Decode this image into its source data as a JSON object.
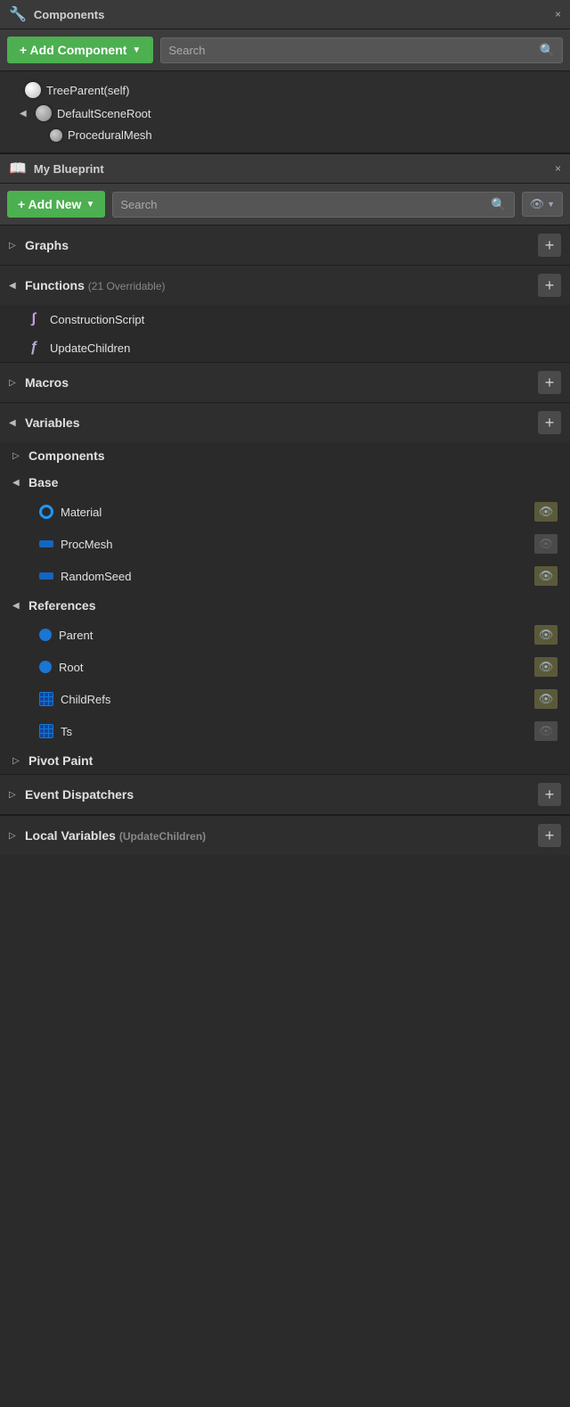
{
  "components_panel": {
    "title": "Components",
    "close_label": "×",
    "add_button_label": "+ Add Component",
    "add_button_arrow": "▼",
    "search_placeholder": "Search",
    "search_icon": "🔍",
    "tree": [
      {
        "id": "tree-parent",
        "label": "TreeParent(self)",
        "icon": "white-ball",
        "indent": 0,
        "arrow": ""
      },
      {
        "id": "default-scene-root",
        "label": "DefaultSceneRoot",
        "icon": "gray-ball",
        "indent": 1,
        "arrow": "◀"
      },
      {
        "id": "procedural-mesh",
        "label": "ProceduralMesh",
        "icon": "small-gray-ball",
        "indent": 2,
        "arrow": ""
      }
    ]
  },
  "blueprint_panel": {
    "title": "My Blueprint",
    "close_label": "×",
    "add_button_label": "+ Add New",
    "add_button_arrow": "▼",
    "search_placeholder": "Search",
    "search_icon": "🔍",
    "eye_label": "👁",
    "eye_arrow": "▼"
  },
  "sections": [
    {
      "id": "graphs",
      "title": "Graphs",
      "subtitle": "",
      "arrow": "▷",
      "has_add": true,
      "items": []
    },
    {
      "id": "functions",
      "title": "Functions",
      "subtitle": "(21 Overridable)",
      "arrow": "◀",
      "has_add": true,
      "items": [
        {
          "id": "construction-script",
          "label": "ConstructionScript",
          "icon_type": "script-override",
          "has_eye": false
        },
        {
          "id": "update-children",
          "label": "UpdateChildren",
          "icon_type": "script",
          "has_eye": false
        }
      ]
    },
    {
      "id": "macros",
      "title": "Macros",
      "subtitle": "",
      "arrow": "▷",
      "has_add": true,
      "items": []
    },
    {
      "id": "variables",
      "title": "Variables",
      "subtitle": "",
      "arrow": "◀",
      "has_add": true,
      "sub_groups": [
        {
          "id": "components-group",
          "label": "Components",
          "arrow": "▷",
          "items": []
        },
        {
          "id": "base-group",
          "label": "Base",
          "arrow": "◀",
          "items": [
            {
              "id": "material",
              "label": "Material",
              "icon_type": "circle-blue",
              "eye": "open"
            },
            {
              "id": "proc-mesh",
              "label": "ProcMesh",
              "icon_type": "rect-blue",
              "eye": "closed"
            },
            {
              "id": "random-seed",
              "label": "RandomSeed",
              "icon_type": "rect-blue",
              "eye": "open"
            }
          ]
        },
        {
          "id": "references-group",
          "label": "References",
          "arrow": "◀",
          "items": [
            {
              "id": "parent",
              "label": "Parent",
              "icon_type": "dot-blue",
              "eye": "open"
            },
            {
              "id": "root",
              "label": "Root",
              "icon_type": "dot-blue",
              "eye": "open"
            },
            {
              "id": "child-refs",
              "label": "ChildRefs",
              "icon_type": "grid-blue",
              "eye": "open"
            },
            {
              "id": "ts",
              "label": "Ts",
              "icon_type": "grid-blue",
              "eye": "closed"
            }
          ]
        },
        {
          "id": "pivot-paint-group",
          "label": "Pivot Paint",
          "arrow": "▷",
          "items": []
        }
      ]
    }
  ],
  "event_dispatchers": {
    "title": "Event Dispatchers",
    "arrow": "▷",
    "has_add": true
  },
  "local_variables": {
    "title": "Local Variables",
    "subtitle": "(UpdateChildren)",
    "arrow": "▷",
    "has_add": true
  }
}
